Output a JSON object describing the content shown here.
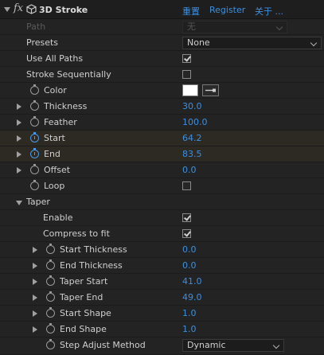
{
  "header": {
    "fx": "fx",
    "effect_name": "3D Stroke",
    "reset": "重置",
    "register": "Register",
    "about": "关于 ..."
  },
  "rows": {
    "path": {
      "label": "Path",
      "value": "无"
    },
    "presets": {
      "label": "Presets",
      "value": "None"
    },
    "use_all_paths": {
      "label": "Use All Paths",
      "checked": true
    },
    "stroke_sequentially": {
      "label": "Stroke Sequentially",
      "checked": false
    },
    "color": {
      "label": "Color",
      "swatch": "#ffffff"
    },
    "thickness": {
      "label": "Thickness",
      "value": "30.0"
    },
    "feather": {
      "label": "Feather",
      "value": "100.0"
    },
    "start": {
      "label": "Start",
      "value": "64.2"
    },
    "end": {
      "label": "End",
      "value": "83.5"
    },
    "offset": {
      "label": "Offset",
      "value": "0.0"
    },
    "loop": {
      "label": "Loop",
      "checked": false
    },
    "taper": {
      "label": "Taper"
    },
    "enable": {
      "label": "Enable",
      "checked": true
    },
    "compress_to_fit": {
      "label": "Compress to fit",
      "checked": true
    },
    "start_thickness": {
      "label": "Start Thickness",
      "value": "0.0"
    },
    "end_thickness": {
      "label": "End Thickness",
      "value": "0.0"
    },
    "taper_start": {
      "label": "Taper Start",
      "value": "41.0"
    },
    "taper_end": {
      "label": "Taper End",
      "value": "49.0"
    },
    "start_shape": {
      "label": "Start Shape",
      "value": "1.0"
    },
    "end_shape": {
      "label": "End Shape",
      "value": "1.0"
    },
    "step_adjust_method": {
      "label": "Step Adjust Method",
      "value": "Dynamic"
    }
  },
  "colors": {
    "background": "#232323",
    "value_blue": "#3d8fe0",
    "keyed_row": "#2c2a22"
  }
}
